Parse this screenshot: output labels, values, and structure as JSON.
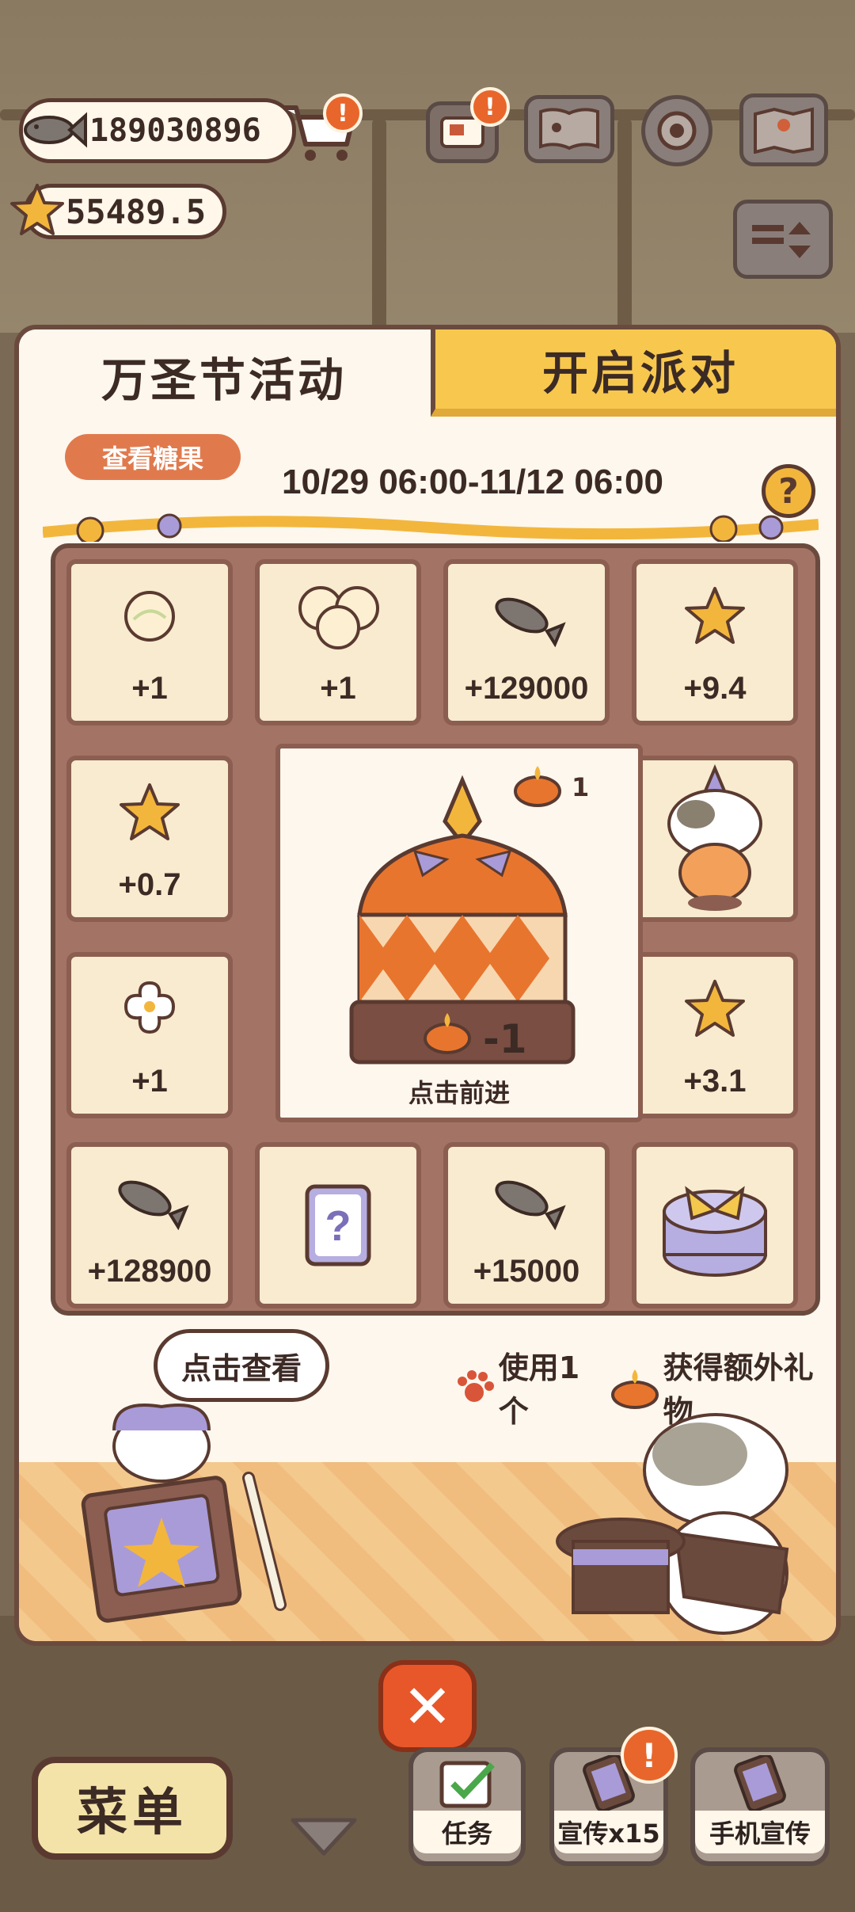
{
  "hud": {
    "fish_count": "189030896",
    "star_count": "55489.5",
    "cart_badge": "!",
    "mail_badge": "!"
  },
  "panel": {
    "tab_active": "万圣节活动",
    "tab_inactive": "开启派对",
    "candy_button": "查看糖果",
    "date_range": "10/29 06:00-11/12 06:00",
    "help": "?"
  },
  "board": {
    "cells": [
      {
        "icon": "yarn-icon",
        "value": "+1"
      },
      {
        "icon": "yarn-bundle-icon",
        "value": "+1"
      },
      {
        "icon": "fish-icon",
        "value": "+129000"
      },
      {
        "icon": "star-icon",
        "value": "+9.4"
      },
      {
        "icon": "star-icon",
        "value": "+0.7"
      },
      {
        "icon": "bone-icon",
        "value": "+1"
      },
      {
        "icon": "star-icon",
        "value": "+3.1"
      },
      {
        "icon": "fish-icon",
        "value": "+128900"
      },
      {
        "icon": "mystery-card-icon",
        "value": "?"
      },
      {
        "icon": "fish-icon",
        "value": "+15000"
      }
    ],
    "center": {
      "candle_count": "1",
      "cost": "-1",
      "advance_label": "点击前进"
    }
  },
  "extra": {
    "use_prefix": "使用1个",
    "use_suffix": "获得额外礼物"
  },
  "speech_bubble": "点击查看",
  "bottom": {
    "close": "✕",
    "menu": "菜单",
    "task": "任务",
    "promo": "宣传x15",
    "phone_promo": "手机宣传",
    "promo_badge": "!"
  },
  "colors": {
    "accent_yellow": "#f7c84d",
    "accent_orange": "#e8572a",
    "border_brown": "#6b4a3e",
    "cell_bg": "#f8ebcf"
  }
}
